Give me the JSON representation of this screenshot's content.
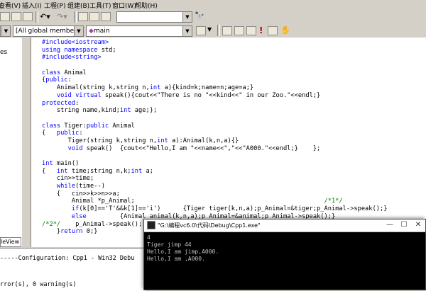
{
  "menubar": {
    "items": [
      "查看(V)",
      "插入(I)",
      "工程(P)",
      "组建(B)",
      "工具(T)",
      "窗口(W)",
      "帮助(H)"
    ]
  },
  "toolbar2": {
    "scope_combo": "[All global members",
    "member_combo": "main"
  },
  "left_pane": {
    "partial_label": "es",
    "tab_label": "leView"
  },
  "editor": {
    "lines": [
      [
        {
          "t": "#include<iostream>",
          "c": "kw"
        }
      ],
      [
        {
          "t": "using namespace",
          "c": "kw"
        },
        {
          "t": " std;",
          "c": ""
        }
      ],
      [
        {
          "t": "#include<string>",
          "c": "kw"
        }
      ],
      [],
      [
        {
          "t": "class",
          "c": "kw"
        },
        {
          "t": " Animal",
          "c": ""
        }
      ],
      [
        {
          "t": "{",
          "c": ""
        },
        {
          "t": "public",
          "c": "kw"
        },
        {
          "t": ":",
          "c": ""
        }
      ],
      [
        {
          "t": "    Animal(string k,string n,",
          "c": ""
        },
        {
          "t": "int",
          "c": "kw"
        },
        {
          "t": " a){kind=k;name=n;age=a;}",
          "c": ""
        }
      ],
      [
        {
          "t": "    ",
          "c": ""
        },
        {
          "t": "void virtual",
          "c": "kw"
        },
        {
          "t": " speak(){cout<<\"There is no \"<<kind<<\" in our Zoo.\"<<endl;}",
          "c": ""
        }
      ],
      [
        {
          "t": "protected",
          "c": "kw"
        },
        {
          "t": ":",
          "c": ""
        }
      ],
      [
        {
          "t": "    string name,kind;",
          "c": ""
        },
        {
          "t": "int",
          "c": "kw"
        },
        {
          "t": " age;};",
          "c": ""
        }
      ],
      [],
      [
        {
          "t": "class",
          "c": "kw"
        },
        {
          "t": " Tiger:",
          "c": ""
        },
        {
          "t": "public",
          "c": "kw"
        },
        {
          "t": " Animal",
          "c": ""
        }
      ],
      [
        {
          "t": "{   ",
          "c": ""
        },
        {
          "t": "public",
          "c": "kw"
        },
        {
          "t": ":",
          "c": ""
        }
      ],
      [
        {
          "t": "       Tiger(string k,string n,",
          "c": ""
        },
        {
          "t": "int",
          "c": "kw"
        },
        {
          "t": " a):Animal(k,n,a){}",
          "c": ""
        }
      ],
      [
        {
          "t": "       ",
          "c": ""
        },
        {
          "t": "void",
          "c": "kw"
        },
        {
          "t": " speak()  {cout<<\"Hello,I am \"<<name<<\",\"<<\"A000.\"<<endl;}    };",
          "c": ""
        }
      ],
      [],
      [
        {
          "t": "int",
          "c": "kw"
        },
        {
          "t": " main()",
          "c": ""
        }
      ],
      [
        {
          "t": "{   ",
          "c": ""
        },
        {
          "t": "int",
          "c": "kw"
        },
        {
          "t": " time;string n,k;",
          "c": ""
        },
        {
          "t": "int",
          "c": "kw"
        },
        {
          "t": " a;",
          "c": ""
        }
      ],
      [
        {
          "t": "    cin>>time;",
          "c": ""
        }
      ],
      [
        {
          "t": "    ",
          "c": ""
        },
        {
          "t": "while",
          "c": "kw"
        },
        {
          "t": "(time--)",
          "c": ""
        }
      ],
      [
        {
          "t": "    {   cin>>k>>n>>a;",
          "c": ""
        }
      ],
      [
        {
          "t": "        Animal *p_Animal;                                                   ",
          "c": ""
        },
        {
          "t": "/*1*/",
          "c": "cm"
        }
      ],
      [
        {
          "t": "        ",
          "c": ""
        },
        {
          "t": "if",
          "c": "kw"
        },
        {
          "t": "(k[0]=='T'&&k[1]=='i')      {Tiger tiger(k,n,a);p_Animal=&tiger;p_Animal->speak();}",
          "c": ""
        }
      ],
      [
        {
          "t": "        ",
          "c": ""
        },
        {
          "t": "else",
          "c": "kw"
        },
        {
          "t": "         {Animal animal(k,n,a);p_Animal=&animal;p_Animal->speak();}",
          "c": ""
        }
      ],
      [
        {
          "t": "/*2*/",
          "c": "cm"
        },
        {
          "t": "    p_Animal->speak();",
          "c": ""
        }
      ],
      [
        {
          "t": "    }",
          "c": ""
        },
        {
          "t": "return",
          "c": "kw"
        },
        {
          "t": " 0;}",
          "c": ""
        }
      ]
    ]
  },
  "output_pane": {
    "config_line": "-----Configuration: Cpp1 - Win32 Debu",
    "result_line": "rror(s), 0 warning(s)"
  },
  "console": {
    "title": "\"G:\\编程vc6.0\\代码\\Debug\\Cpp1.exe\"",
    "minimize": "—",
    "maximize": "☐",
    "close": "✕",
    "output": "4\nTiger jimp 44\nHello,I am jimp,A000.\nHello,I am ,A000."
  }
}
